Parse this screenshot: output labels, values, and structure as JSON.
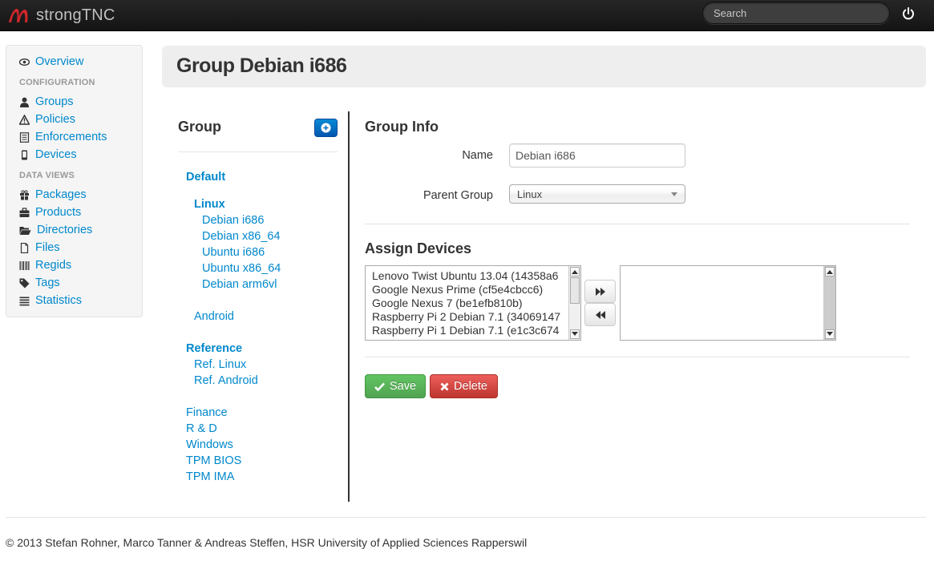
{
  "navbar": {
    "brand": "strongTNC",
    "search_placeholder": "Search",
    "logo_icon": "strongswan-logo-icon",
    "power_icon": "power-icon"
  },
  "sidebar": {
    "items_top": [
      {
        "label": "Overview",
        "icon": "eye-icon"
      }
    ],
    "config_header": "CONFIGURATION",
    "config_items": [
      {
        "label": "Groups",
        "icon": "user-icon"
      },
      {
        "label": "Policies",
        "icon": "warning-icon"
      },
      {
        "label": "Enforcements",
        "icon": "list-icon"
      },
      {
        "label": "Devices",
        "icon": "phone-icon"
      }
    ],
    "data_header": "DATA VIEWS",
    "data_items": [
      {
        "label": "Packages",
        "icon": "gift-icon"
      },
      {
        "label": "Products",
        "icon": "briefcase-icon"
      },
      {
        "label": "Directories",
        "icon": "folder-open-icon"
      },
      {
        "label": "Files",
        "icon": "file-icon"
      },
      {
        "label": "Regids",
        "icon": "barcode-icon"
      },
      {
        "label": "Tags",
        "icon": "tag-icon"
      },
      {
        "label": "Statistics",
        "icon": "align-justify-icon"
      }
    ]
  },
  "page_title": "Group Debian i686",
  "groups_panel": {
    "heading": "Group",
    "tree": [
      {
        "label": "Default",
        "level": 0,
        "bold": true
      },
      {
        "label": "Linux",
        "level": 1,
        "bold": true
      },
      {
        "label": "Debian i686",
        "level": 2,
        "bold": false
      },
      {
        "label": "Debian x86_64",
        "level": 2,
        "bold": false
      },
      {
        "label": "Ubuntu i686",
        "level": 2,
        "bold": false
      },
      {
        "label": "Ubuntu x86_64",
        "level": 2,
        "bold": false
      },
      {
        "label": "Debian arm6vl",
        "level": 2,
        "bold": false
      },
      {
        "label": "Android",
        "level": 1,
        "bold": false
      },
      {
        "label": "Reference",
        "level": 0,
        "bold": true
      },
      {
        "label": "Ref. Linux",
        "level": 1,
        "bold": false
      },
      {
        "label": "Ref. Android",
        "level": 1,
        "bold": false
      },
      {
        "label": "Finance",
        "level": 0,
        "bold": false
      },
      {
        "label": "R & D",
        "level": 0,
        "bold": false
      },
      {
        "label": "Windows",
        "level": 0,
        "bold": false
      },
      {
        "label": "TPM BIOS",
        "level": 0,
        "bold": false
      },
      {
        "label": "TPM IMA",
        "level": 0,
        "bold": false
      }
    ]
  },
  "group_info": {
    "heading": "Group Info",
    "name_label": "Name",
    "name_value": "Debian i686",
    "parent_label": "Parent Group",
    "parent_value": "Linux"
  },
  "assign_devices": {
    "heading": "Assign Devices",
    "available": [
      "Lenovo Twist Ubuntu 13.04 (14358a6",
      "Google Nexus Prime (cf5e4cbcc6)",
      "Google Nexus 7 (be1efb810b)",
      "Raspberry Pi 2 Debian 7.1 (34069147",
      "Raspberry Pi 1 Debian 7.1 (e1c3c674"
    ],
    "assigned": []
  },
  "actions": {
    "save": "Save",
    "delete": "Delete"
  },
  "footer": "© 2013 Stefan Rohner, Marco Tanner & Andreas Steffen, HSR University of Applied Sciences Rapperswil"
}
